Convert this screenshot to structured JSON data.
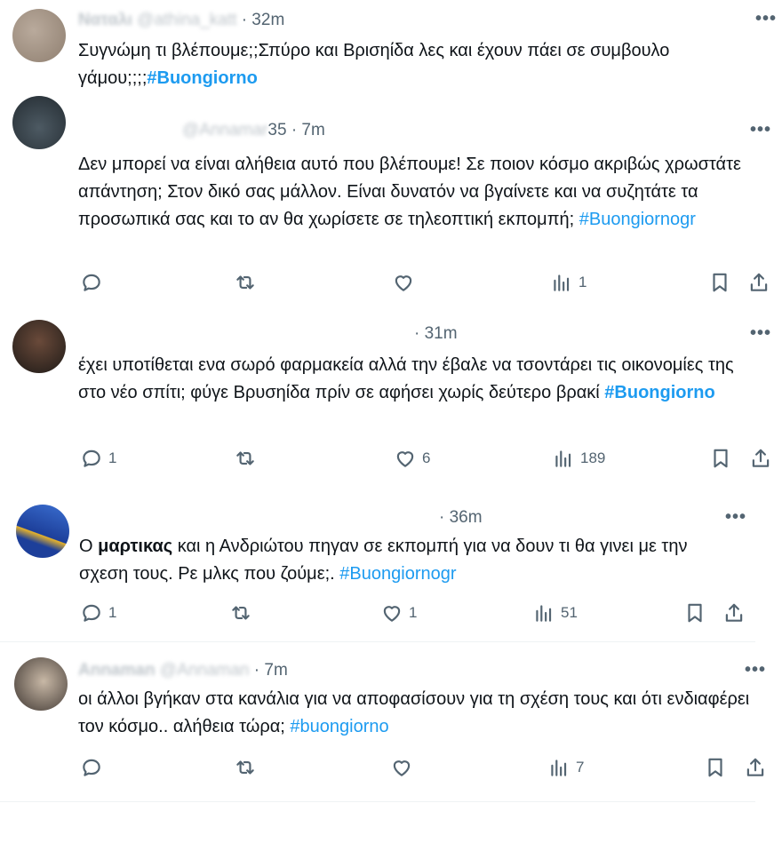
{
  "colors": {
    "text": "#0f1419",
    "muted": "#536471",
    "link": "#1d9bf0",
    "divider": "#eff3f4"
  },
  "more_label": "•••",
  "tweets": [
    {
      "handle_obscured": "@athina_katt",
      "name_obscured": "Ναταλι",
      "time": "· 32m",
      "text": "Συγνώμη τι βλέπουμε;;Σπύρο και Βρισηίδα λες και έχουν πάει σε συμβουλο γάμου;;;;",
      "hashtag": "#Buongiorno"
    },
    {
      "handle_obscured": "@Annamar",
      "handle_visible": "35",
      "time": "· 7m",
      "text": "Δεν μπορεί να είναι αλήθεια αυτό που βλέπουμε! Σε ποιον κόσμο ακριβώς χρωστάτε απάντηση; Στον δικό σας μάλλον. Είναι δυνατόν να βγαίνετε και να συζητάτε τα προσωπικά σας και το αν θα χωρίσετε σε τηλεοπτική εκπομπή;",
      "hashtag": "#Buongiornogr",
      "replies": "",
      "retweets": "",
      "likes": "",
      "views": "1"
    },
    {
      "time": "· 31m",
      "text": "έχει υποτίθεται ενα σωρό φαρμακεία αλλά την έβαλε να τσοντάρει τις οικονομίες της στο νέο σπίτι; φύγε Βρυσηίδα πρίν σε αφήσει χωρίς δεύτερο βρακί",
      "hashtag": "#Buongiorno",
      "replies": "1",
      "retweets": "",
      "likes": "6",
      "views": "189"
    },
    {
      "time": "· 36m",
      "text_before": "Ο ",
      "text_name": "μαρτικας",
      "text_after": " και η Ανδριώτου πηγαν σε εκπομπή για να δουν τι θα γινει με την σχεση τους. Ρε μλκς που ζούμε;.",
      "hashtag": "#Buongiornogr",
      "replies": "1",
      "retweets": "",
      "likes": "1",
      "views": "51"
    },
    {
      "name_obscured": "Annaman",
      "handle_obscured": "@Annaman",
      "time": "· 7m",
      "text": "οι άλλοι βγήκαν στα κανάλια για να αποφασίσουν για τη σχέση τους και ότι ενδιαφέρει τον κόσμο.. αλήθεια τώρα;",
      "hashtag": "#buongiorno",
      "replies": "",
      "retweets": "",
      "likes": "",
      "views": "7"
    }
  ]
}
